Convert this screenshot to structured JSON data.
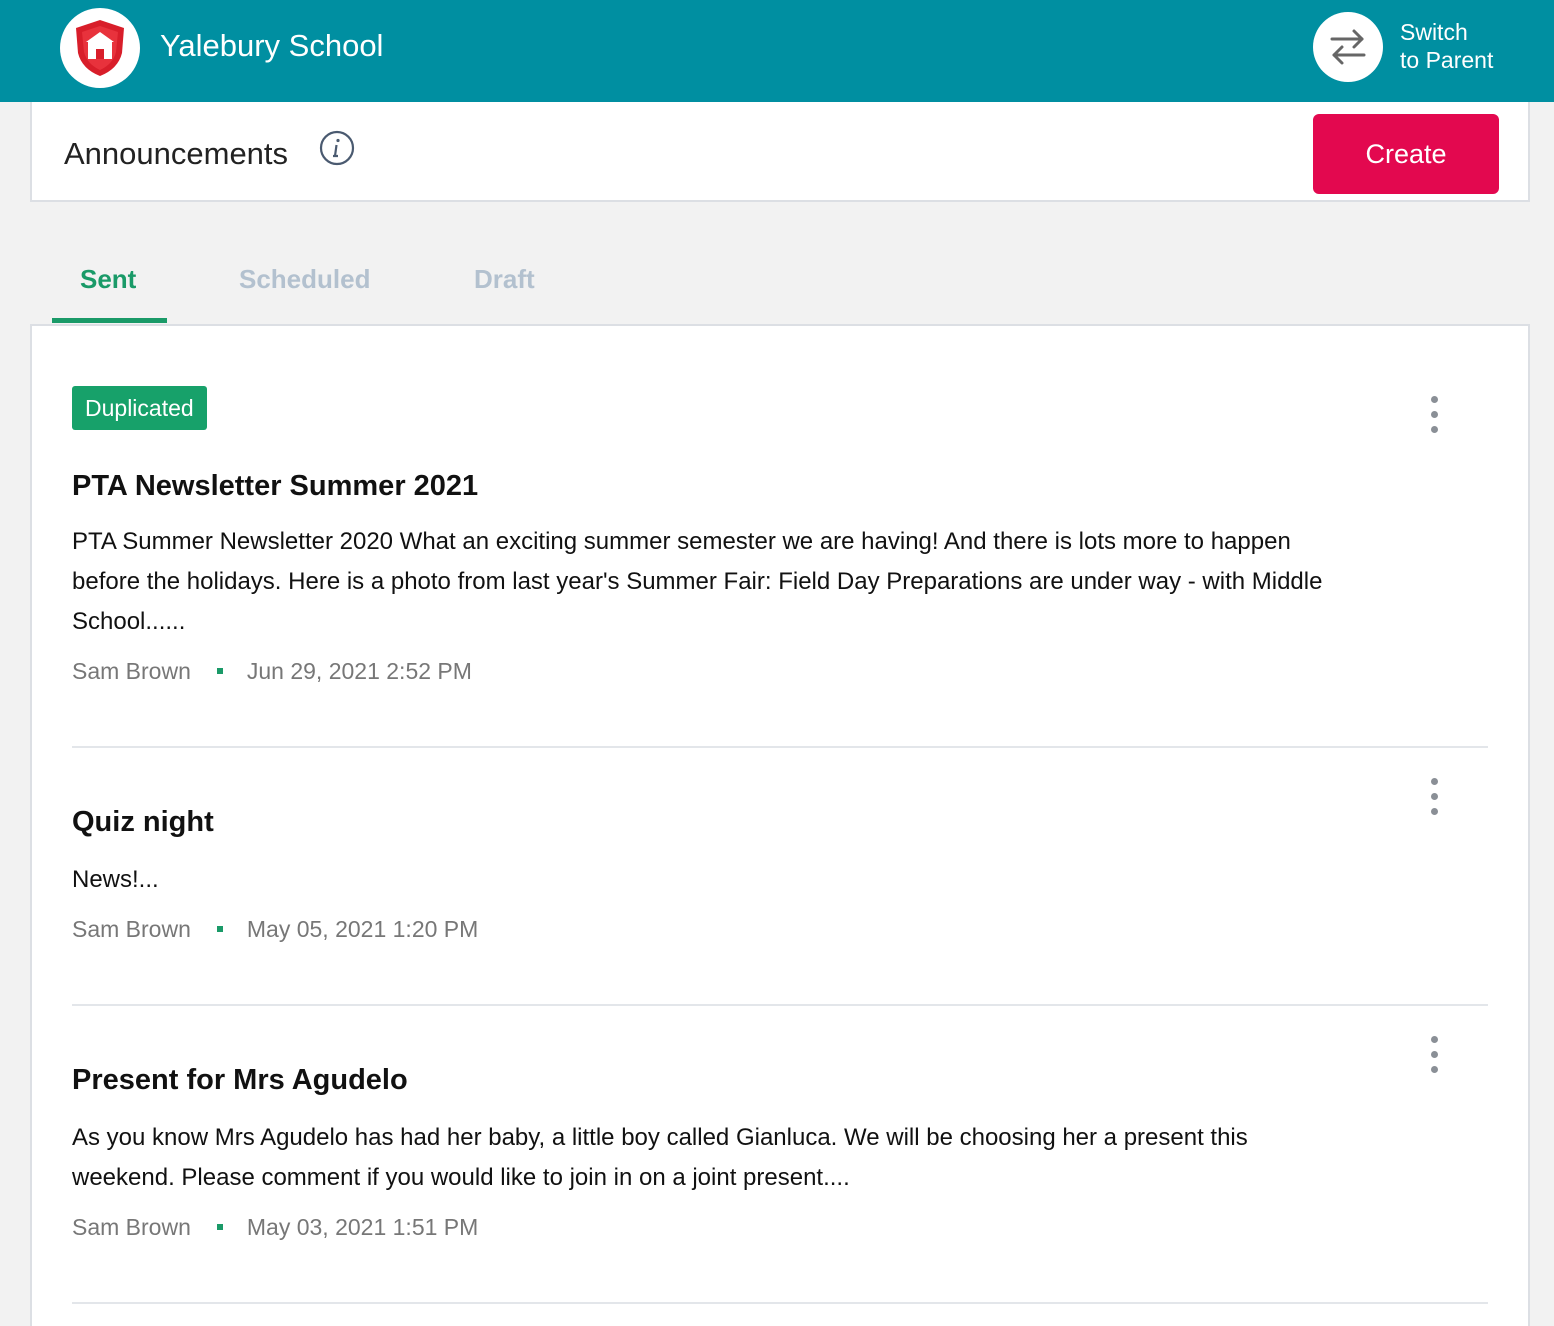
{
  "app": {
    "school_name": "Yalebury School",
    "switch_line1": "Switch",
    "switch_line2": "to Parent",
    "brand_color": "#008fa1"
  },
  "header": {
    "title": "Announcements",
    "create_label": "Create",
    "create_color": "#e3084f"
  },
  "tabs": [
    {
      "label": "Sent",
      "active": true
    },
    {
      "label": "Scheduled",
      "active": false
    },
    {
      "label": "Draft",
      "active": false
    }
  ],
  "announcements": [
    {
      "badge": "Duplicated",
      "title": "PTA Newsletter Summer 2021",
      "body": "PTA Summer Newsletter 2020 What an exciting summer semester we are having! And there is lots more to happen before the holidays. Here is a photo from last year's Summer Fair: Field Day Preparations are under way - with Middle School......",
      "author": "Sam Brown",
      "date": "Jun 29, 2021 2:52 PM"
    },
    {
      "badge": "",
      "title": "Quiz night",
      "body": "News!...",
      "author": "Sam Brown",
      "date": "May 05, 2021 1:20 PM"
    },
    {
      "badge": "",
      "title": "Present for Mrs Agudelo",
      "body": "As you know Mrs Agudelo has had her baby, a little boy called Gianluca. We will be choosing her a present this weekend. Please comment if you would like to join in on a joint present....",
      "author": "Sam Brown",
      "date": "May 03, 2021 1:51 PM"
    }
  ]
}
